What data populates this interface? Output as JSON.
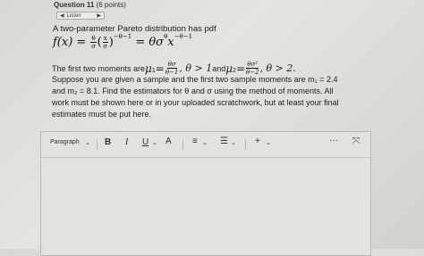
{
  "question": {
    "title": "Question 11",
    "points": "(6 points)"
  },
  "listen": {
    "label": "Listen",
    "speaker_icon": "speaker-icon",
    "play_icon": "play-icon"
  },
  "intro": "A two-parameter Pareto distribution has pdf",
  "formula": {
    "lhs": "f(x) =",
    "frac1_num": "θ",
    "frac1_den": "σ",
    "frac2_num": "x",
    "frac2_den": "σ",
    "exp1": "−θ−1",
    "mid": "= θσ",
    "sup_theta": "θ",
    "x": "x",
    "exp2": "−θ−1"
  },
  "moments": {
    "line1_pre": "The first two moments are ",
    "mu1": "μ",
    "mu1_sub": "1",
    "eq": " = ",
    "mu1_num": "θσ",
    "mu1_den": "θ−1",
    "cond1": ", θ > 1",
    "and": " and ",
    "mu2": "μ",
    "mu2_sub": "2",
    "mu2_num": "θσ²",
    "mu2_den": "θ−2",
    "cond2": ", θ > 2."
  },
  "text_lines": [
    "Suppose you are given a sample and the first two sample moments are m₁ = 2.4",
    "and m₂ = 8.1. Find the estimators for θ and σ using the method of moments. All",
    "work must be shown here or in your uploaded scratchwork, but at least your final",
    "estimates must be put here."
  ],
  "toolbar": {
    "paragraph": "Paragraph",
    "bold": "B",
    "italic": "I",
    "underline": "U",
    "chevron": "⌄",
    "text_color": "A",
    "align": "≡",
    "list": "☰",
    "plus": "+",
    "more": "···",
    "expand": "⤧"
  }
}
